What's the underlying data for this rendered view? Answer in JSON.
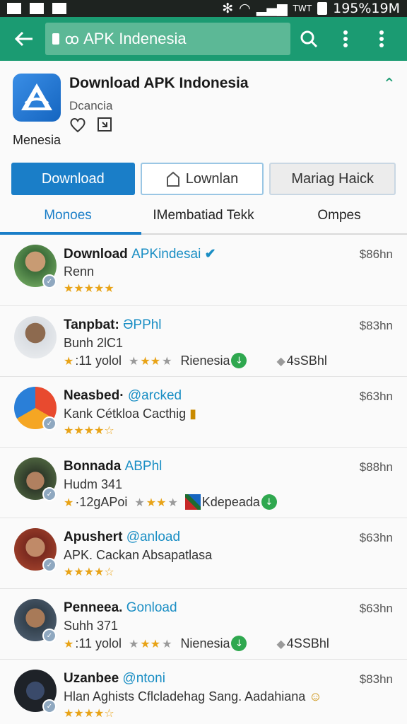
{
  "status": {
    "right_text": "195%19M",
    "network": "TWT"
  },
  "toolbar": {
    "url_text": "APK Indenesia"
  },
  "app": {
    "title": "Download APK Indonesia",
    "developer": "Dcancia",
    "note": "Menesia"
  },
  "buttons": {
    "download": "Download",
    "lownlan": "Lownlan",
    "mariag": "Mariag Haick"
  },
  "tabs": [
    "Monoes",
    "IMembatiad Tekk",
    "Ompes"
  ],
  "rows": [
    {
      "name": "Download ",
      "handle": "APKindesai",
      "sub": "Renn",
      "price": "$86hn"
    },
    {
      "name": "Tanpbat: ",
      "handle": "ƏPPhl",
      "sub": "Bunh 2lC1",
      "price": "$83hn",
      "rating_text": ":11 yolol",
      "tag": "Rienesia",
      "count": "4sSBhl"
    },
    {
      "name": "Neasbed· ",
      "handle": "@arcked",
      "sub": "Kank Cétkloa Cacthig",
      "price": "$63hn"
    },
    {
      "name": "Bonnada ",
      "handle": "ABPhl",
      "sub": "Hudm 341",
      "price": "$88hn",
      "rating_text": "·12gAPoi",
      "tag": "Kdepeada"
    },
    {
      "name": "Apushert ",
      "handle": "@anload",
      "sub": "APK. Cackan Absapatlasa",
      "price": "$63hn"
    },
    {
      "name": "Penneea. ",
      "handle": "Gonload",
      "sub": "Suhh 371",
      "price": "$63hn",
      "rating_text": ":11 yolol",
      "tag": "Nienesia",
      "count": "4SSBhl"
    },
    {
      "name": "Uzanbee ",
      "handle": "@ntoni",
      "sub": "Hlan Aghists Cflcladehag Sang. Aadahiana",
      "price": "$83hn"
    }
  ]
}
